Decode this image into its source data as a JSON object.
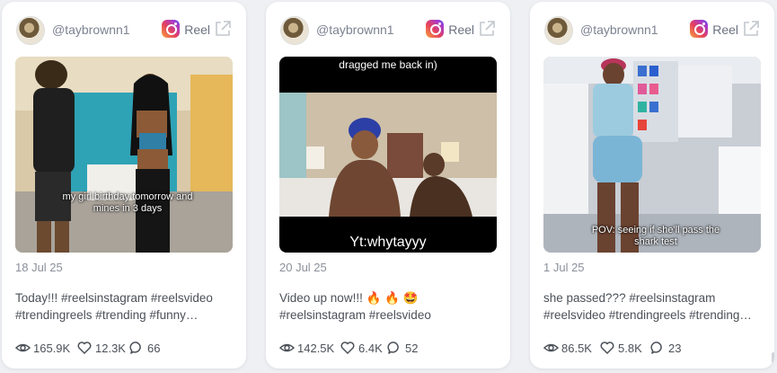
{
  "posts": [
    {
      "handle": "@taybrownn1",
      "type_label": "Reel",
      "caption_overlay": "my girl birthday tomorrow and mines in 3 days",
      "date": "18 Jul 25",
      "description": "Today!!! #reelsinstagram #reelsvideo #trendingreels #trending #funny…",
      "views": "165.9K",
      "likes": "12.3K",
      "comments": "66"
    },
    {
      "handle": "@taybrownn1",
      "type_label": "Reel",
      "caption_top": "dragged me back in)",
      "caption_bottom": "Yt:whytayyy",
      "date": "20 Jul 25",
      "description": "Video up now!!! 🔥 🔥 🤩 #reelsinstagram #reelsvideo #trendingreels #trending…",
      "views": "142.5K",
      "likes": "6.4K",
      "comments": "52"
    },
    {
      "handle": "@taybrownn1",
      "type_label": "Reel",
      "caption_overlay": "POV: seeing if she'll pass the shark test",
      "date": "1 Jul 25",
      "description": "she passed??? #reelsinstagram #reelsvideo #trendingreels #trending…",
      "views": "86.5K",
      "likes": "5.8K",
      "comments": "23"
    }
  ],
  "colors": {
    "page_bg": "#eef0f4",
    "card_bg": "#ffffff",
    "muted_text": "#8a909a",
    "body_text": "#4b5058"
  },
  "icons": [
    "avatar",
    "instagram-icon",
    "external-link-icon",
    "eye-icon",
    "heart-icon",
    "comment-icon"
  ]
}
